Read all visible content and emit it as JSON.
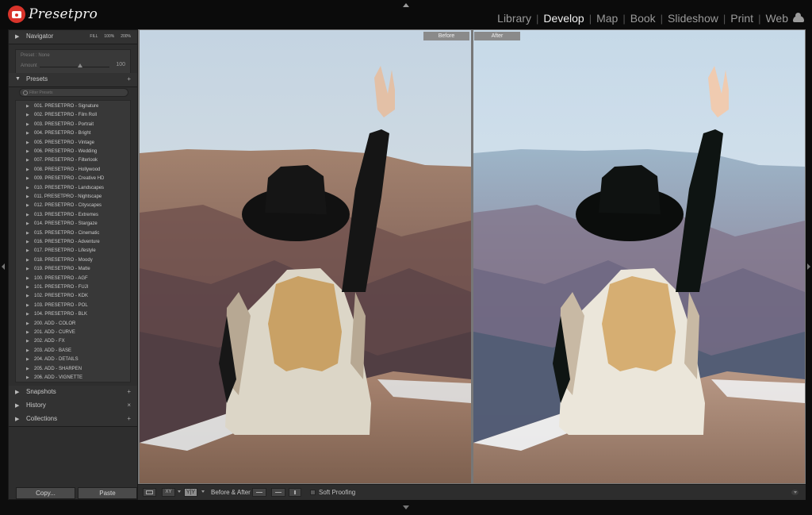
{
  "app": {
    "logo_text": "Presetpro",
    "logo_icon": "camera-icon"
  },
  "modules": [
    {
      "label": "Library",
      "active": false
    },
    {
      "label": "Develop",
      "active": true
    },
    {
      "label": "Map",
      "active": false
    },
    {
      "label": "Book",
      "active": false
    },
    {
      "label": "Slideshow",
      "active": false
    },
    {
      "label": "Print",
      "active": false
    },
    {
      "label": "Web",
      "active": false
    }
  ],
  "module_separator": "|",
  "navigator": {
    "title": "Navigator",
    "options": [
      "FILL",
      "100%",
      "200%"
    ],
    "preset_label": "Preset : None",
    "amount_label": "Amount",
    "amount_value": "100",
    "amount_fraction": 0.58
  },
  "presets": {
    "title": "Presets",
    "add_symbol": "+",
    "search_placeholder": "Filter Presets",
    "items": [
      "001. PRESETPRO - Signature",
      "002. PRESETPRO - Film Roll",
      "003. PRESETPRO - Portrait",
      "004. PRESETPRO - Bright",
      "005. PRESETPRO - Vintage",
      "006. PRESETPRO - Wedding",
      "007. PRESETPRO - Filterlook",
      "008. PRESETPRO - Hollywood",
      "009. PRESETPRO - Creative HD",
      "010. PRESETPRO - Landscapes",
      "011. PRESETPRO - Nightscape",
      "012. PRESETPRO - Cityscapes",
      "013. PRESETPRO - Extremes",
      "014. PRESETPRO - Stargaze",
      "015. PRESETPRO - Cinematic",
      "016. PRESETPRO - Adventure",
      "017. PRESETPRO - Lifestyle",
      "018. PRESETPRO - Moody",
      "019. PRESETPRO - Matte",
      "100. PRESETPRO - AGF",
      "101. PRESETPRO - FUJI",
      "102. PRESETPRO - KDK",
      "103. PRESETPRO - POL",
      "104. PRESETPRO - BLK",
      "200. ADD - COLOR",
      "201. ADD - CURVE",
      "202. ADD - FX",
      "203. ADD - BASE",
      "204. ADD - DETAILS",
      "205. ADD - SHARPEN",
      "206. ADD - VIGNETTE"
    ]
  },
  "snapshots": {
    "title": "Snapshots",
    "action": "+"
  },
  "history": {
    "title": "History",
    "action": "×"
  },
  "collections": {
    "title": "Collections",
    "action": "+"
  },
  "buttons": {
    "copy": "Copy...",
    "paste": "Paste"
  },
  "compare": {
    "before_label": "Before",
    "after_label": "After"
  },
  "toolbar": {
    "xy_label": "XY",
    "yy_label": "Y|Y",
    "before_after_label": "Before & After :",
    "soft_proofing_label": "Soft Proofing"
  },
  "colors": {
    "background": "#0d0d0d",
    "panel": "#2e2e2e",
    "active_module": "#f0f0f0",
    "inactive_module": "#9a9a9a",
    "logo_red": "#d9342b"
  }
}
